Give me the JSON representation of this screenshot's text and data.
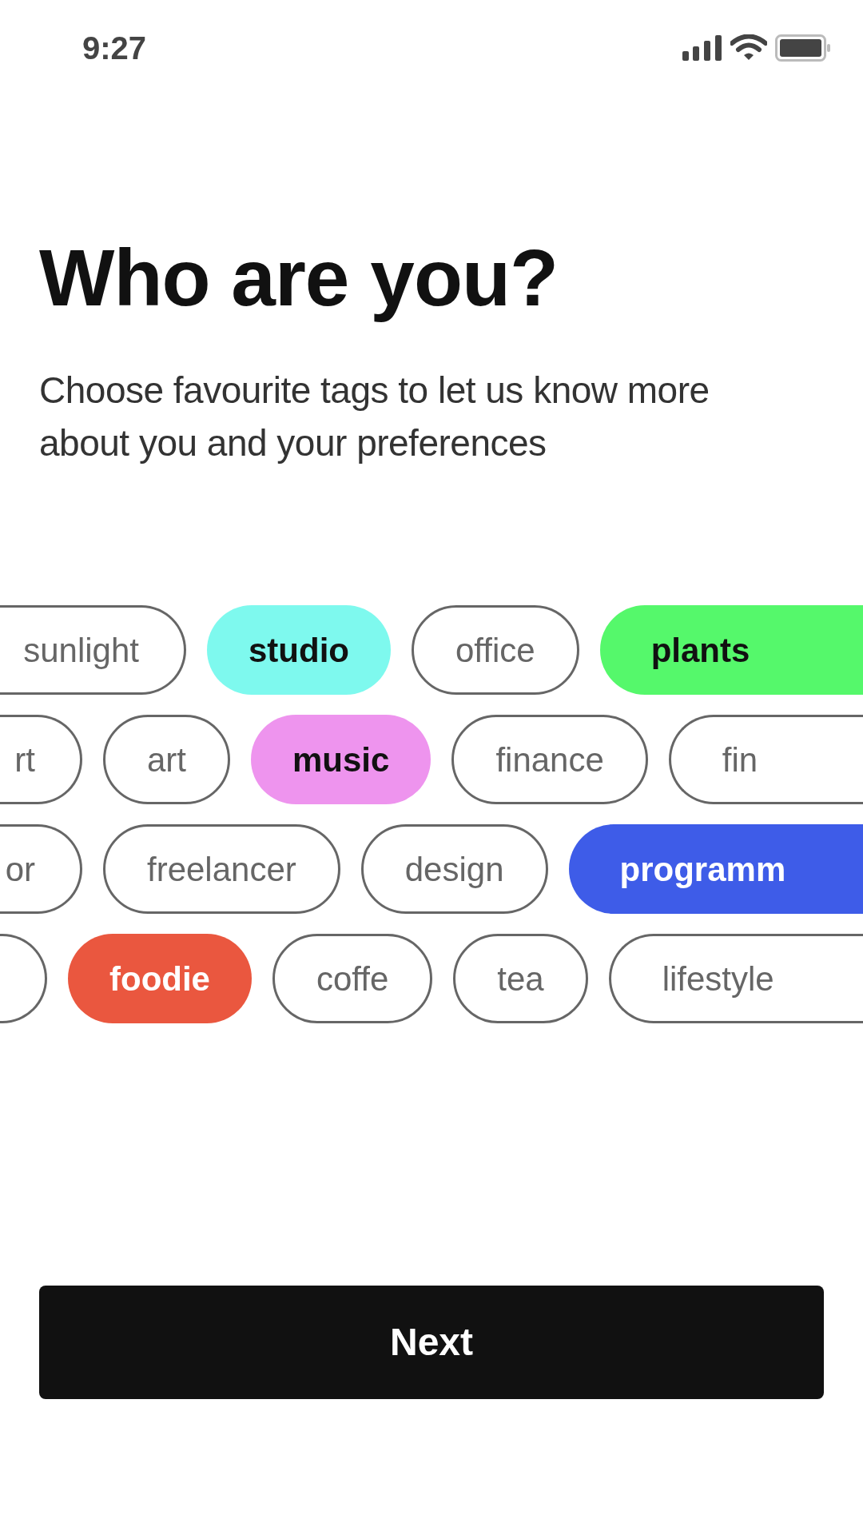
{
  "status_bar": {
    "time": "9:27"
  },
  "title": "Who are you?",
  "subtitle": "Choose favourite tags to let us know more about you and your preferences",
  "tag_rows": [
    {
      "tags": [
        {
          "label": "sunlight",
          "selected": false
        },
        {
          "label": "studio",
          "selected": true,
          "color": "#7ef9ee"
        },
        {
          "label": "office",
          "selected": false
        },
        {
          "label": "plants",
          "selected": true,
          "color": "#55f86b"
        }
      ]
    },
    {
      "tags": [
        {
          "label": "rt",
          "selected": false
        },
        {
          "label": "art",
          "selected": false
        },
        {
          "label": "music",
          "selected": true,
          "color": "#ee94ee"
        },
        {
          "label": "finance",
          "selected": false
        },
        {
          "label": "fin",
          "selected": false
        }
      ]
    },
    {
      "tags": [
        {
          "label": "or",
          "selected": false
        },
        {
          "label": "freelancer",
          "selected": false
        },
        {
          "label": "design",
          "selected": false
        },
        {
          "label": "programm",
          "selected": true,
          "color": "#3e5ce8"
        }
      ]
    },
    {
      "tags": [
        {
          "selected": false
        },
        {
          "label": "foodie",
          "selected": true,
          "color": "#ea573f"
        },
        {
          "label": "coffe",
          "selected": false
        },
        {
          "label": "tea",
          "selected": false
        },
        {
          "label": "lifestyle",
          "selected": false
        }
      ]
    }
  ],
  "next_button": "Next"
}
